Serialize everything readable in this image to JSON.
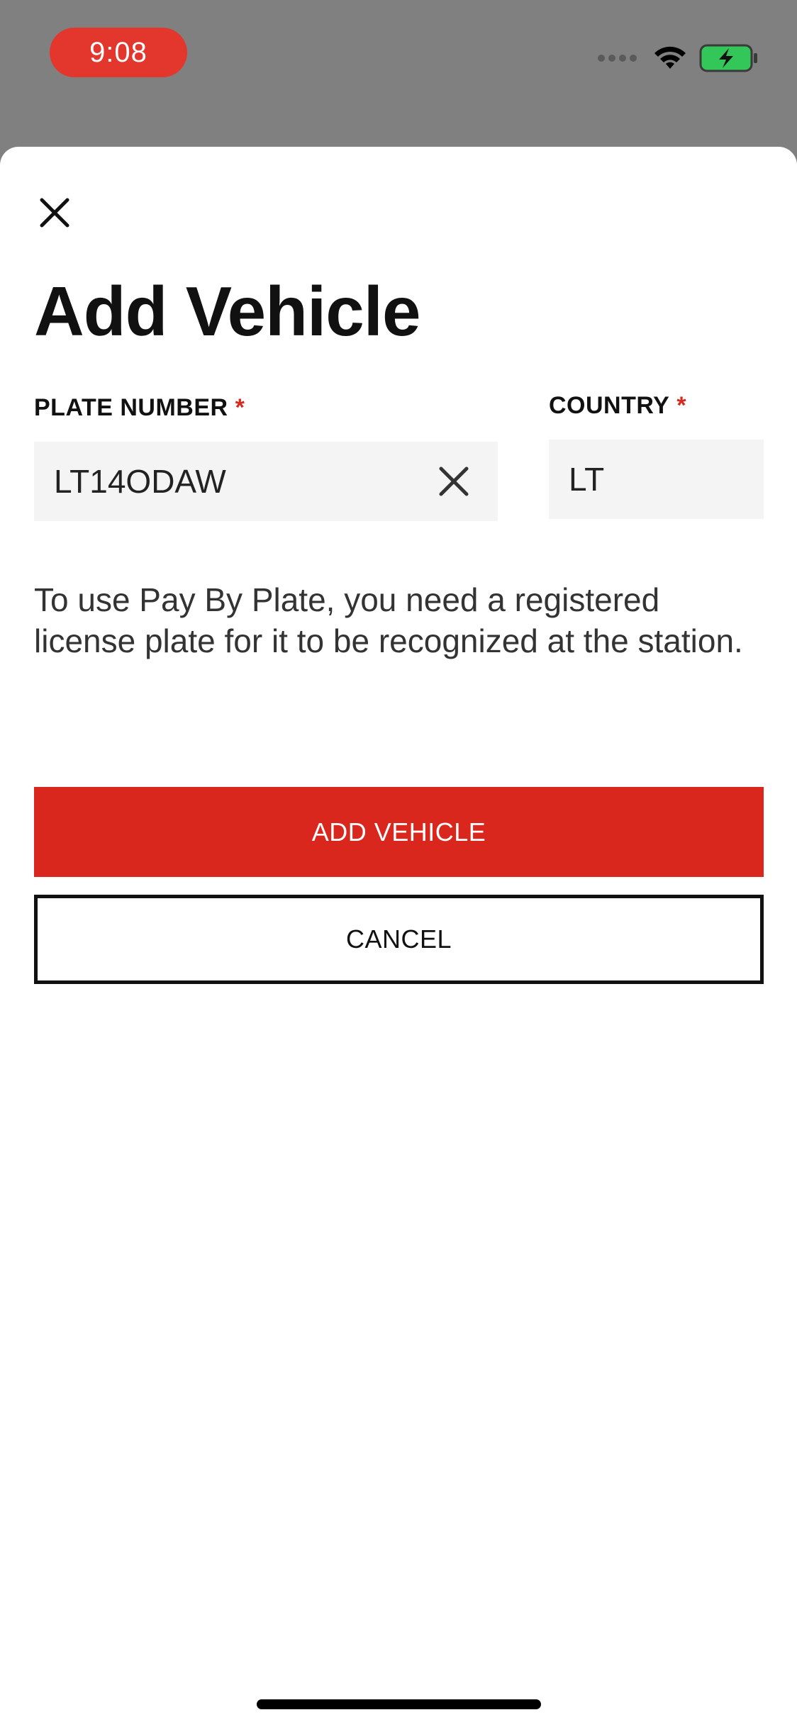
{
  "status_bar": {
    "time": "9:08",
    "accent_color": "#e3362c",
    "icons": [
      "signal-dots-icon",
      "wifi-icon",
      "battery-charging-icon"
    ]
  },
  "sheet": {
    "close_icon": "close-icon",
    "title": "Add Vehicle",
    "plate_field": {
      "label": "PLATE NUMBER",
      "required_mark": "*",
      "value": "LT14ODAW",
      "clear_icon": "clear-icon"
    },
    "country_field": {
      "label": "COUNTRY",
      "required_mark": "*",
      "value": "LT"
    },
    "info_text": "To use Pay By Plate, you need a registered license plate for it to be recognized at the station.",
    "primary_button": {
      "label": "ADD VEHICLE",
      "color": "#d9271d"
    },
    "secondary_button": {
      "label": "CANCEL"
    }
  }
}
